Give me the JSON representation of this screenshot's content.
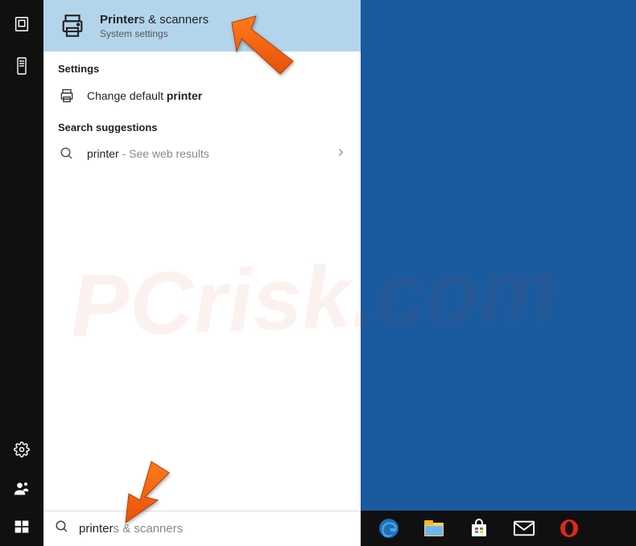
{
  "bestMatch": {
    "title_prefix": "Printer",
    "title_suffix": "s & scanners",
    "subtitle": "System settings"
  },
  "sections": {
    "settings": "Settings",
    "suggestions": "Search suggestions"
  },
  "settingsResults": {
    "changeDefault_pre": "Change default ",
    "changeDefault_bold": "printer"
  },
  "webSuggestion": {
    "query": "printer",
    "hint": " - See web results"
  },
  "searchBox": {
    "typed": "printer",
    "completion": "s & scanners"
  },
  "watermark": "PCrisk.com"
}
